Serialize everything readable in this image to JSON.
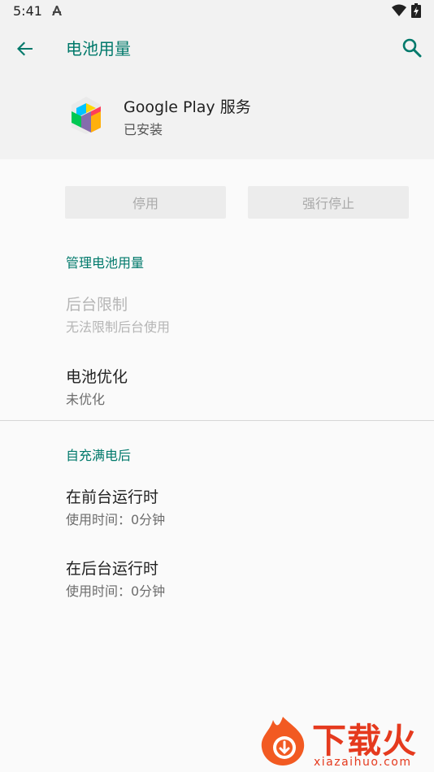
{
  "status_bar": {
    "time": "5:41"
  },
  "header": {
    "title": "电池用量"
  },
  "app": {
    "name": "Google Play 服务",
    "status": "已安装"
  },
  "buttons": {
    "disable_label": "停用",
    "force_stop_label": "强行停止"
  },
  "battery_section": {
    "header": "管理电池用量",
    "background_restriction": {
      "title": "后台限制",
      "summary": "无法限制后台使用",
      "enabled": false
    },
    "battery_optimization": {
      "title": "电池优化",
      "summary": "未优化"
    }
  },
  "since_full_charge": {
    "header": "自充满电后",
    "items": [
      {
        "title": "在前台运行时",
        "summary": "使用时间：0分钟"
      },
      {
        "title": "在后台运行时",
        "summary": "使用时间：0分钟"
      }
    ]
  },
  "watermark": {
    "title": "下载火",
    "url": "xiazaihuo.com"
  },
  "colors": {
    "accent": "#00796b",
    "background": "#fafafa",
    "header_background": "#f2f2f2",
    "button_background": "#ececec",
    "watermark": "#e53a1e"
  },
  "icons": [
    "a-icon",
    "wifi-icon",
    "battery-icon",
    "back-arrow-icon",
    "search-icon",
    "google-play-services-icon",
    "watermark-logo-icon"
  ]
}
